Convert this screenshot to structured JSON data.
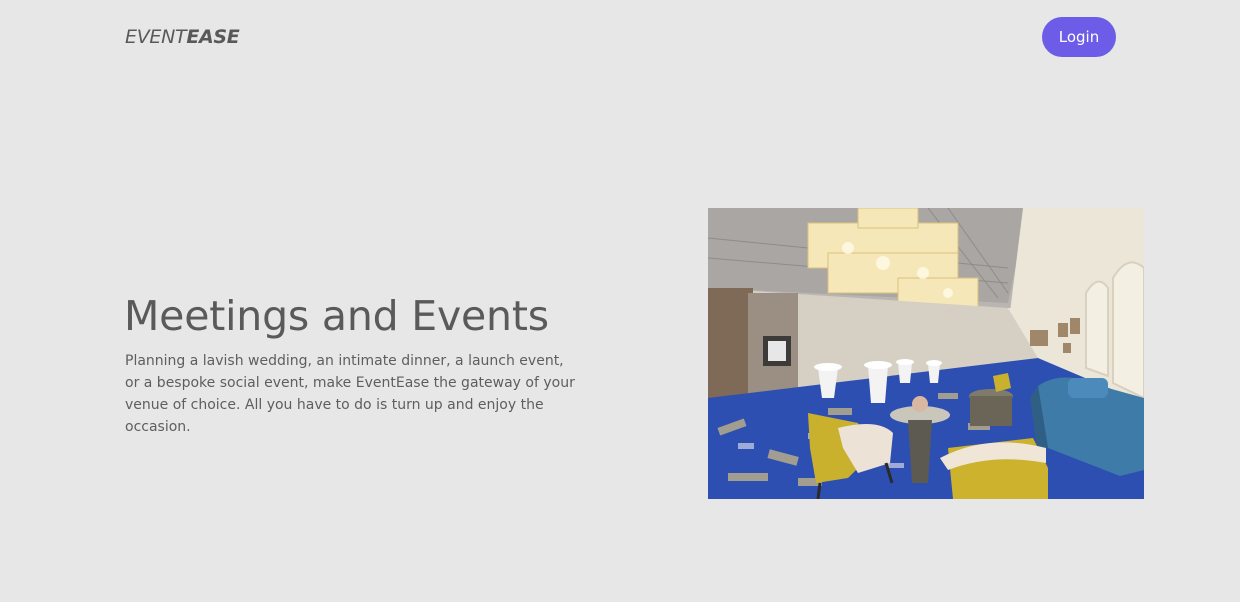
{
  "header": {
    "logo_light": "EVENT",
    "logo_bold": "EASE",
    "login_label": "Login"
  },
  "hero": {
    "title": "Meetings and Events",
    "description": "Planning a lavish wedding, an intimate dinner, a launch event, or a bespoke social event, make EventEase the gateway of your venue of choice. All you have to do is turn up and enjoy the occasion."
  },
  "colors": {
    "background": "#e8e7e8",
    "accent": "#6c5ce7",
    "text": "#5a5a5a"
  }
}
